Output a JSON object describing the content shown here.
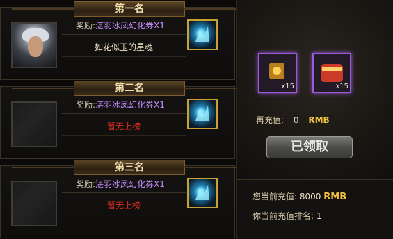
{
  "ranks": [
    {
      "title": "第一名",
      "reward_prefix": "奖励:",
      "reward_item": "湛羽冰凤幻化券X1",
      "player": "如花似玉的星魂",
      "has_player": true
    },
    {
      "title": "第二名",
      "reward_prefix": "奖励:",
      "reward_item": "湛羽冰凤幻化券X1",
      "player": "暂无上榜",
      "has_player": false
    },
    {
      "title": "第三名",
      "reward_prefix": "奖励:",
      "reward_item": "湛羽冰凤幻化券X1",
      "player": "暂无上榜",
      "has_player": false
    }
  ],
  "right": {
    "items": [
      {
        "name": "pendant-item",
        "qty": "x15"
      },
      {
        "name": "scroll-item",
        "qty": "x15"
      }
    ],
    "recharge_label": "再充值:",
    "recharge_value": "0",
    "recharge_unit": "RMB",
    "button_label": "已领取",
    "current_label": "您当前充值:",
    "current_value": "8000",
    "current_unit": "RMB",
    "rank_label": "你当前充值排名:",
    "rank_value": "1"
  },
  "colors": {
    "gold_accent": "#f0c040",
    "rank_none": "#e02c20",
    "purple_frame": "#9a5bd8"
  }
}
